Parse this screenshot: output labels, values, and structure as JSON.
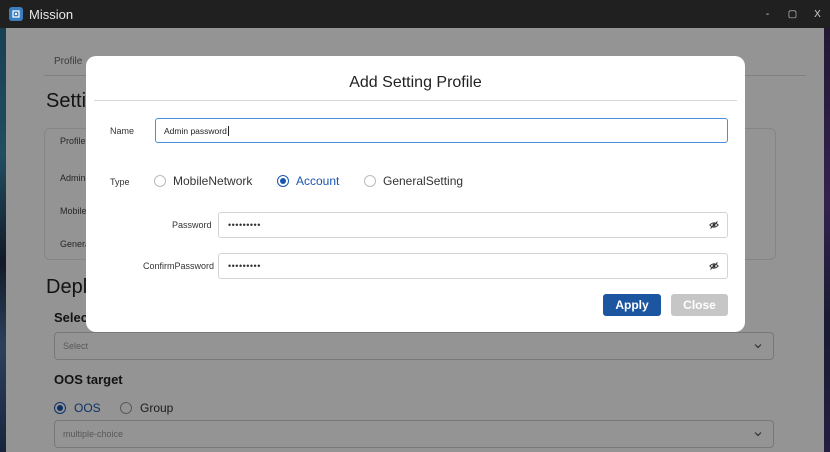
{
  "window": {
    "title": "Mission",
    "minimize": "-",
    "maximize": "▢",
    "close": "X"
  },
  "background": {
    "tab_profile": "Profile",
    "setting_title": "Settin",
    "profile_label": "Profile",
    "row1": "Admin",
    "row2": "MobileN",
    "row3": "Genera",
    "deploy_title": "Deplo",
    "select_title": "Select",
    "select_placeholder": "Select",
    "oos_target_title": "OOS target",
    "radio_oos": "OOS",
    "radio_group": "Group",
    "multi_placeholder": "multiple-choice"
  },
  "modal": {
    "title": "Add Setting Profile",
    "name_label": "Name",
    "name_value": "Admin password",
    "type_label": "Type",
    "type_options": [
      "MobileNetwork",
      "Account",
      "GeneralSetting"
    ],
    "type_selected": "Account",
    "password_label": "Password",
    "password_value": "•••••••••",
    "confirm_label": "ConfirmPassword",
    "confirm_value": "•••••••••",
    "apply_label": "Apply",
    "close_label": "Close"
  },
  "colors": {
    "accent": "#1c55a0",
    "disabled": "#c6c6c6",
    "focus": "#4a90d9"
  }
}
